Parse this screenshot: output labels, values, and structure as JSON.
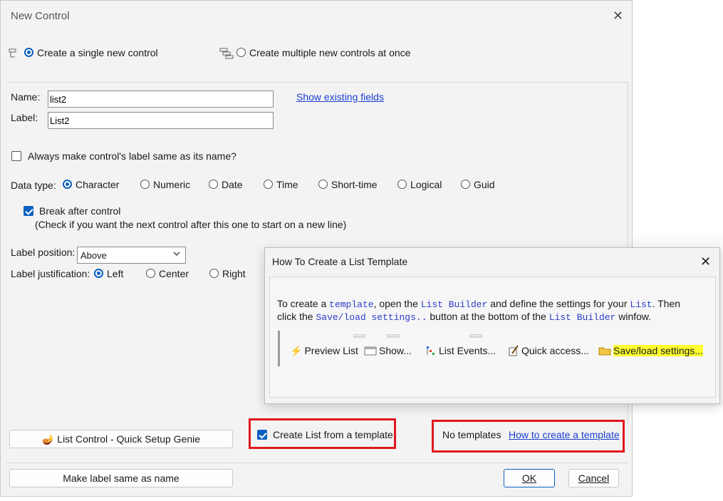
{
  "dialog": {
    "title": "New Control",
    "mode": {
      "single_label": "Create a single new control",
      "multiple_label": "Create multiple new controls at once",
      "selected": "single"
    },
    "name_label": "Name:",
    "name_value": "list2",
    "label_label": "Label:",
    "label_value": "List2",
    "show_fields_link": "Show existing fields",
    "always_same_label": "Always make control's label same as its name?",
    "always_same_checked": false,
    "data_type_label": "Data type:",
    "data_types": [
      "Character",
      "Numeric",
      "Date",
      "Time",
      "Short-time",
      "Logical",
      "Guid"
    ],
    "data_type_selected": "Character",
    "break_after_label": "Break after control",
    "break_after_checked": true,
    "break_after_hint": "(Check if you want the next control after this one to start on a new line)",
    "label_position_label": "Label position:",
    "label_position_value": "Above",
    "label_just_label": "Label justification:",
    "justifications": [
      "Left",
      "Center",
      "Right"
    ],
    "justification_selected": "Left",
    "genie_button": "List Control - Quick Setup Genie",
    "template_checkbox_label": "Create List from a template",
    "template_checked": true,
    "no_templates_text": "No templates",
    "how_to_link": "How to create a template",
    "make_label_button": "Make label same as name",
    "ok_button": "OK",
    "cancel_button": "Cancel"
  },
  "popup": {
    "title": "How To Create a List Template",
    "text_1": "To create a ",
    "code_template": "template",
    "text_2": ", open the ",
    "code_list_builder": "List Builder",
    "text_3": " and define the settings for your ",
    "code_list": "List",
    "text_4": ". Then",
    "text_5": "click the ",
    "code_save_load": "Save/load settings..",
    "text_6": " button at the bottom of the ",
    "code_list_builder_2": "List Builder",
    "text_7": " winfow.",
    "toolbar": [
      {
        "icon": "lightning-icon",
        "label": "Preview List"
      },
      {
        "icon": "window-icon",
        "label": "Show..."
      },
      {
        "icon": "events-icon",
        "label": "List Events..."
      },
      {
        "icon": "edit-icon",
        "label": "Quick access..."
      },
      {
        "icon": "folder-icon",
        "label": "Save/load settings...",
        "highlight": "#ffff30"
      }
    ]
  },
  "colors": {
    "accent": "#0a5fc0",
    "link": "#1a3fd0",
    "highlight_box": "#e0161d"
  }
}
